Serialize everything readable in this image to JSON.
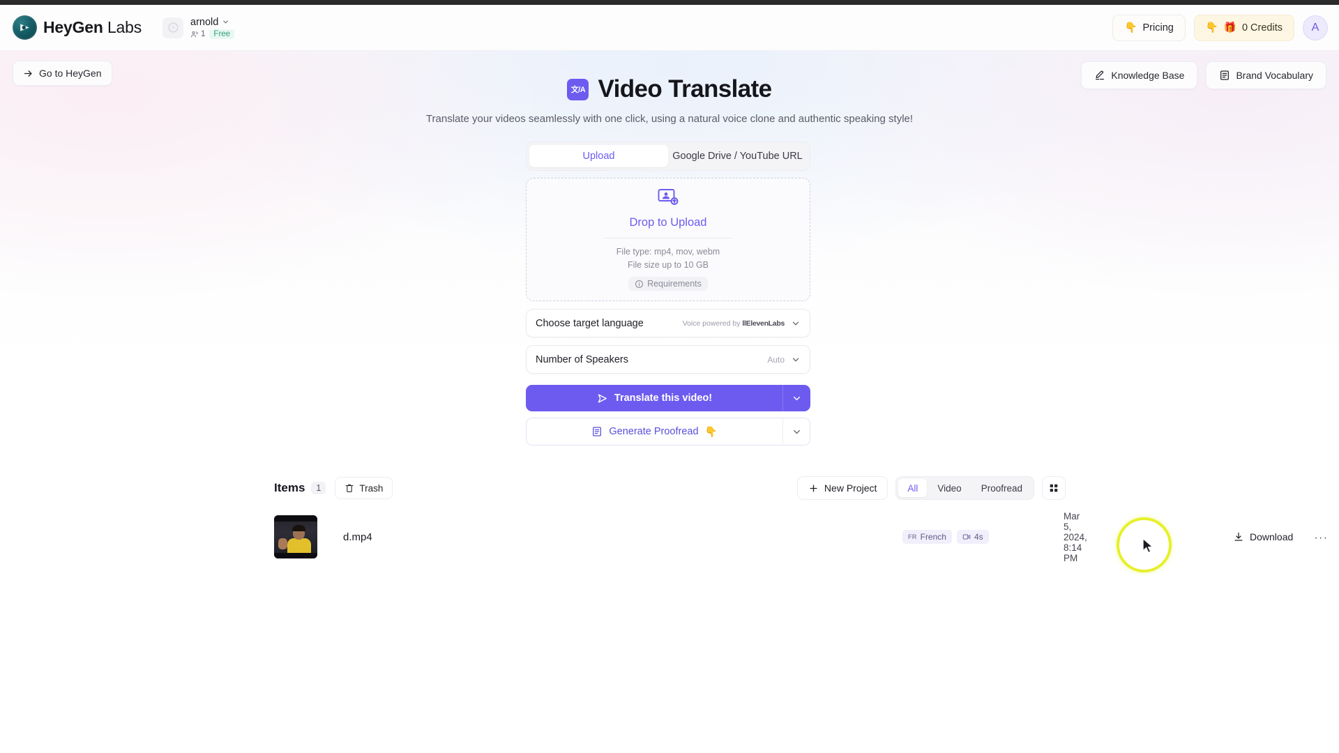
{
  "header": {
    "brand_bold": "HeyGen",
    "brand_light": "Labs",
    "logo_icon": "heygen-play-logo",
    "workspace": {
      "name": "arnold",
      "seats": "1",
      "plan": "Free",
      "avatar_icon": "workspace-avatar-icon",
      "chevron_icon": "chevron-down-icon",
      "seats_icon": "people-icon"
    },
    "pricing_label": "Pricing",
    "pricing_icon": "hand-point-icon",
    "credits_label": "0 Credits",
    "credits_icon": "gift-icon",
    "credits_hand_icon": "hand-point-icon",
    "user_initial": "A"
  },
  "top_actions": {
    "go_to_heygen": "Go to HeyGen",
    "go_to_heygen_icon": "arrow-right-icon",
    "knowledge_base": "Knowledge Base",
    "knowledge_base_icon": "pen-underline-icon",
    "brand_vocabulary": "Brand Vocabulary",
    "brand_vocabulary_icon": "document-lines-icon"
  },
  "hero": {
    "icon_text": "文/A",
    "icon_name": "translate-icon",
    "title": "Video Translate",
    "subtitle": "Translate your videos seamlessly with one click, using a natural voice clone and authentic speaking style!"
  },
  "tabs": [
    {
      "label": "Upload",
      "active": true
    },
    {
      "label": "Google Drive / YouTube URL",
      "active": false
    }
  ],
  "dropzone": {
    "icon": "upload-video-icon",
    "title": "Drop to Upload",
    "file_type": "File type: mp4, mov, webm",
    "file_size": "File size up to 10 GB",
    "requirements_label": "Requirements",
    "requirements_icon": "info-circle-icon"
  },
  "selects": [
    {
      "label": "Choose target language",
      "hint_prefix": "Voice powered by ",
      "hint_brand": "llElevenLabs",
      "value": "",
      "chevron_icon": "chevron-down-icon"
    },
    {
      "label": "Number of Speakers",
      "hint_prefix": "",
      "hint_brand": "",
      "value": "Auto",
      "chevron_icon": "chevron-down-icon"
    }
  ],
  "actions": {
    "translate_label": "Translate this video!",
    "translate_icon": "play-outline-icon",
    "translate_caret_icon": "chevron-down-icon",
    "proofread_label": "Generate Proofread ",
    "proofread_icon": "document-lines-icon",
    "proofread_emoji": "👇",
    "proofread_caret_icon": "chevron-down-icon"
  },
  "items": {
    "title": "Items",
    "count": "1",
    "trash_label": "Trash",
    "trash_icon": "trash-icon",
    "new_project_label": "New Project",
    "new_project_icon": "plus-icon",
    "filters": [
      {
        "label": "All",
        "active": true
      },
      {
        "label": "Video",
        "active": false
      },
      {
        "label": "Proofread",
        "active": false
      }
    ],
    "grid_view_icon": "grid-view-icon"
  },
  "row": {
    "thumbnail_name": "video-thumbnail",
    "file_name": "d.mp4",
    "language_code": "FR",
    "language": "French",
    "duration": "4s",
    "duration_icon": "video-camera-icon",
    "date": "Mar 5, 2024, 8:14 PM",
    "download_label": "Download",
    "download_icon": "download-icon",
    "more_label": "···"
  },
  "cursor": {
    "name": "mouse-pointer",
    "highlight_color": "#e6f02a"
  },
  "colors": {
    "accent": "#6d5bf0",
    "credits_bg": "#fdf6e3",
    "plan_green": "#2f9e7e"
  }
}
